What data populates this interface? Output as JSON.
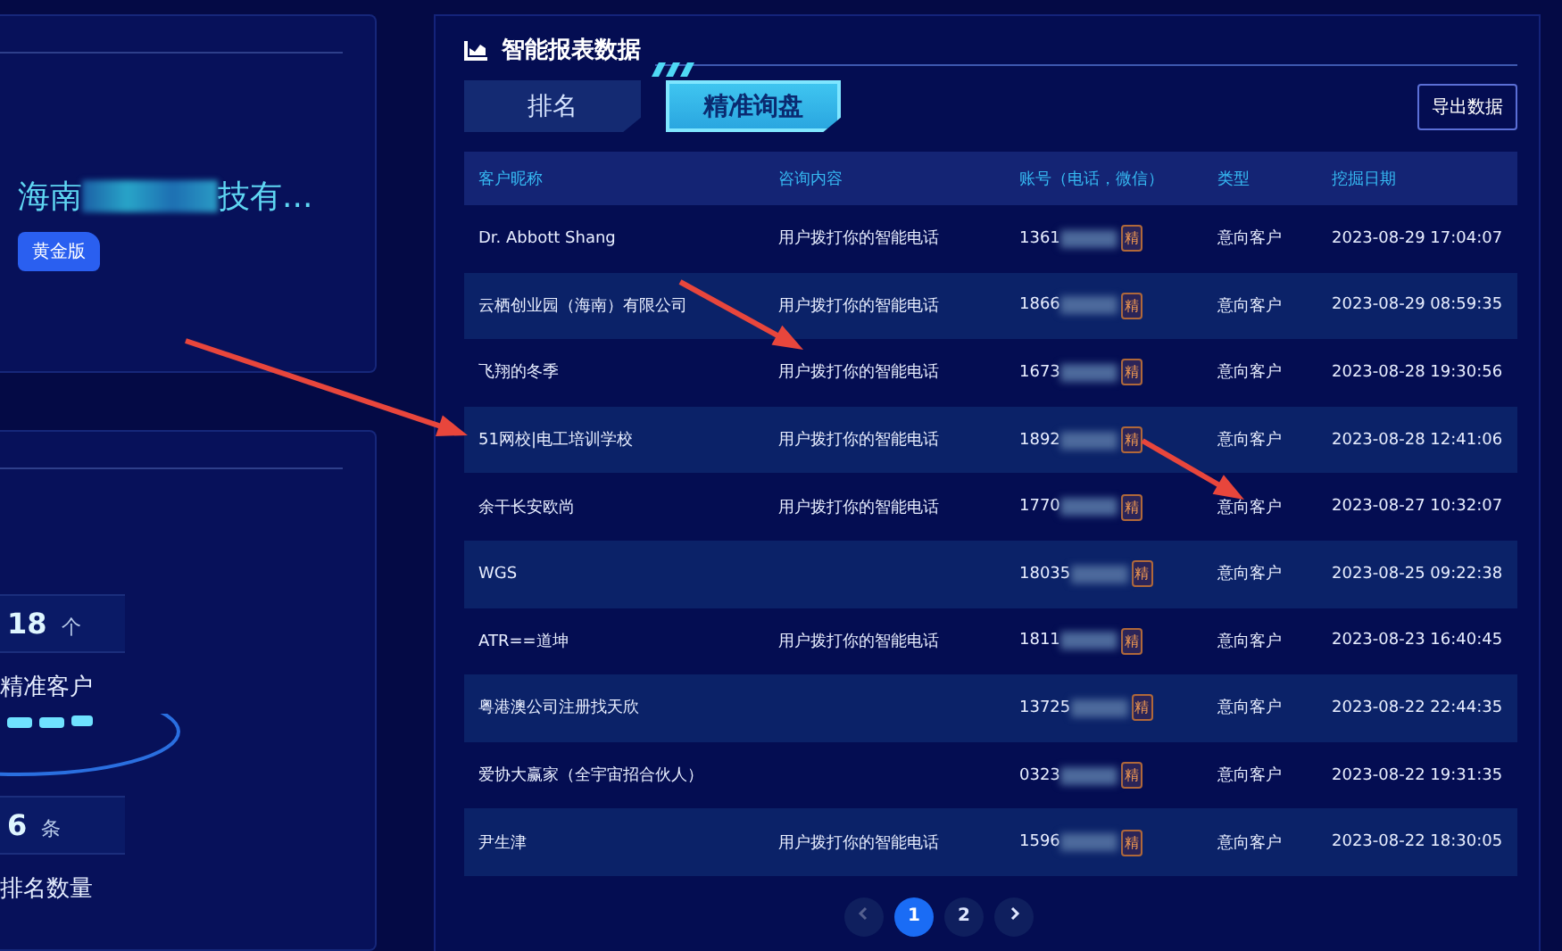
{
  "company": {
    "name_start": "海南",
    "name_end": "技有...",
    "plan": "黄金版"
  },
  "stats": [
    {
      "value": "18",
      "unit": "个",
      "label": "精准客户"
    },
    {
      "value": "6",
      "unit": "条",
      "label": "排名数量"
    }
  ],
  "report": {
    "title": "智能报表数据",
    "tabs": [
      {
        "label": "排名",
        "selected": false
      },
      {
        "label": "精准询盘",
        "selected": true
      }
    ],
    "export_button": "导出数据",
    "columns": [
      "客户昵称",
      "咨询内容",
      "账号（电话，微信）",
      "类型",
      "挖掘日期"
    ],
    "rows": [
      {
        "name": "Dr. Abbott Shang",
        "content": "用户拨打你的智能电话",
        "account": "1361",
        "badge": "精",
        "type": "意向客户",
        "date": "2023-08-29 17:04:07"
      },
      {
        "name": "云栖创业园（海南）有限公司",
        "content": "用户拨打你的智能电话",
        "account": "1866",
        "badge": "精",
        "type": "意向客户",
        "date": "2023-08-29 08:59:35"
      },
      {
        "name": "飞翔的冬季",
        "content": "用户拨打你的智能电话",
        "account": "1673",
        "badge": "精",
        "type": "意向客户",
        "date": "2023-08-28 19:30:56"
      },
      {
        "name": "51网校|电工培训学校",
        "content": "用户拨打你的智能电话",
        "account": "1892",
        "badge": "精",
        "type": "意向客户",
        "date": "2023-08-28 12:41:06"
      },
      {
        "name": "余干长安欧尚",
        "content": "用户拨打你的智能电话",
        "account": "1770",
        "badge": "精",
        "type": "意向客户",
        "date": "2023-08-27 10:32:07"
      },
      {
        "name": "WGS",
        "account": "18035",
        "badge": "精",
        "type": "意向客户",
        "date": "2023-08-25 09:22:38"
      },
      {
        "name": "ATR==道坤",
        "content": "用户拨打你的智能电话",
        "account": "1811",
        "badge": "精",
        "type": "意向客户",
        "date": "2023-08-23 16:40:45"
      },
      {
        "name": "粤港澳公司注册找天欣",
        "account": "13725",
        "badge": "精",
        "type": "意向客户",
        "date": "2023-08-22 22:44:35"
      },
      {
        "name": "爱协大赢家（全宇宙招合伙人）",
        "account": "0323",
        "badge": "精",
        "type": "意向客户",
        "date": "2023-08-22 19:31:35"
      },
      {
        "name": "尹生津",
        "content": "用户拨打你的智能电话",
        "account": "1596",
        "badge": "精",
        "type": "意向客户",
        "date": "2023-08-22 18:30:05"
      }
    ],
    "pages": [
      {
        "label": "1",
        "selected": true
      },
      {
        "label": "2",
        "selected": false
      }
    ]
  }
}
